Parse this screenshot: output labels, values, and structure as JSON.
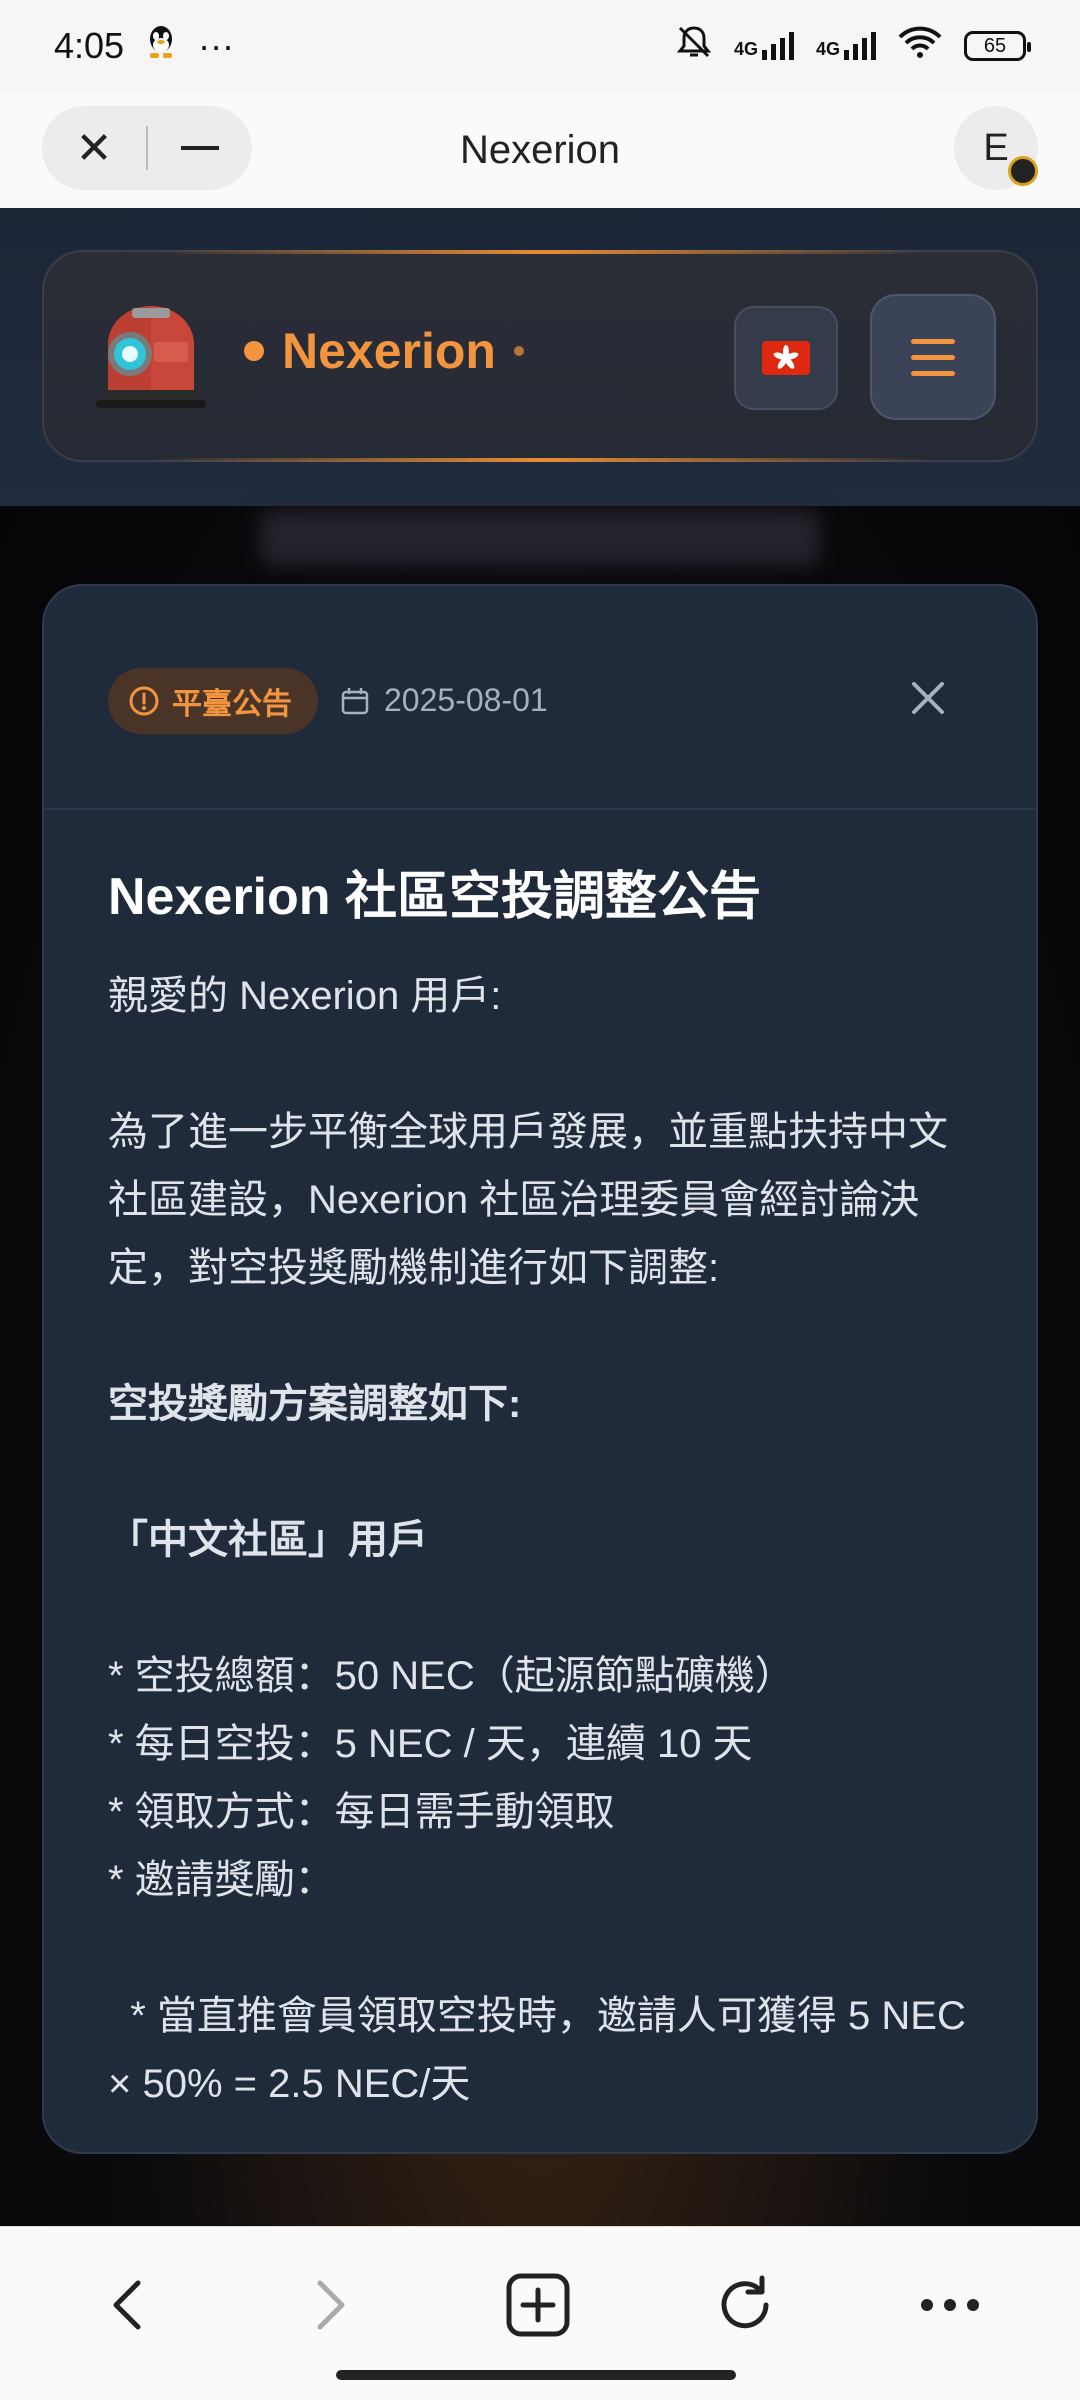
{
  "status_bar": {
    "time": "4:05",
    "dots": "···",
    "net1": "4G",
    "net2": "4G",
    "battery": "65"
  },
  "browser": {
    "title": "Nexerion",
    "avatar_letter": "E"
  },
  "site": {
    "brand": "Nexerion",
    "accent_color": "#f3943e"
  },
  "modal": {
    "tag_label": "平臺公告",
    "date": "2025-08-01",
    "title": "Nexerion 社區空投調整公告",
    "greeting": "親愛的 Nexerion 用戶:",
    "intro": "為了進一步平衡全球用戶發展，並重點扶持中文社區建設，Nexerion 社區治理委員會經討論決定，對空投獎勵機制進行如下調整:",
    "section_title": "空投獎勵方案調整如下:",
    "group_title": "「中文社區」用戶",
    "bullets": [
      "* 空投總額：50 NEC（起源節點礦機）",
      "* 每日空投：5 NEC / 天，連續 10 天",
      "* 領取方式：每日需手動領取",
      "* 邀請獎勵："
    ],
    "sub_bullet": "  * 當直推會員領取空投時，邀請人可獲得 5 NEC × 50% = 2.5 NEC/天"
  }
}
